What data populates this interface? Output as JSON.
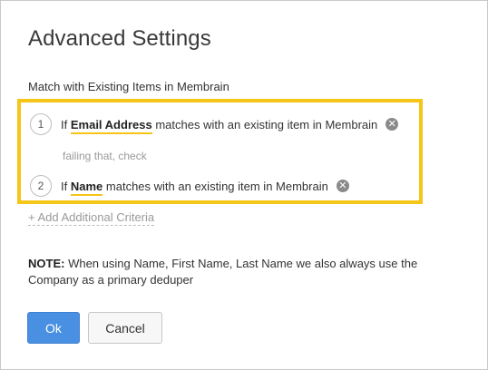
{
  "dialog": {
    "title": "Advanced Settings",
    "section_label": "Match with Existing Items in Membrain"
  },
  "criteria": [
    {
      "number": "1",
      "prefix": "If",
      "field": "Email Address",
      "suffix": "matches with an existing item in Membrain",
      "remove_icon": "close-circle-icon"
    },
    {
      "number": "2",
      "prefix": "If",
      "field": "Name",
      "suffix": "matches with an existing item in Membrain",
      "remove_icon": "close-circle-icon"
    }
  ],
  "failing_text": "failing that, check",
  "add_criteria_label": "+ Add Additional Criteria",
  "note": {
    "label": "NOTE:",
    "text": "When using Name, First Name, Last Name we also always use the Company as a primary deduper"
  },
  "buttons": {
    "ok": "Ok",
    "cancel": "Cancel"
  },
  "colors": {
    "highlight": "#f5c518",
    "primary": "#4a90e2"
  }
}
